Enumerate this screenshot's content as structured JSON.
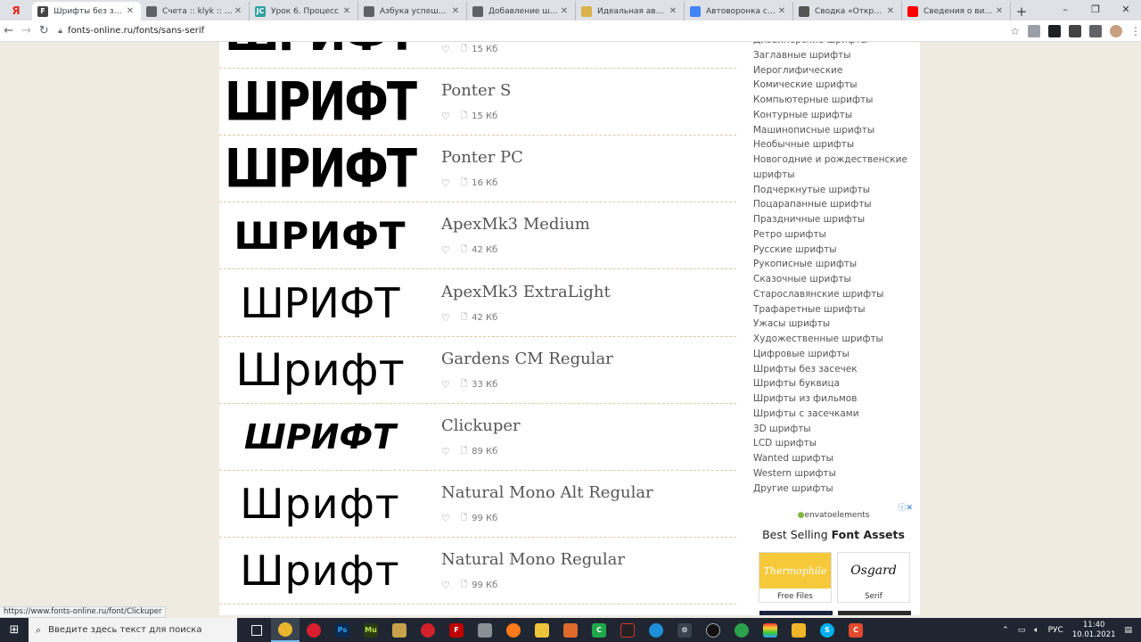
{
  "browser": {
    "tabs": [
      {
        "title": "Шрифты без засечек",
        "color": "#ffffff",
        "fav_text": "F",
        "fav_color": "#444444",
        "active": true
      },
      {
        "title": "Счета :: klyk :: justclick",
        "color": "",
        "fav_text": "",
        "fav_color": "#5f6368"
      },
      {
        "title": "Урок 6. Процесс",
        "color": "",
        "fav_text": "JC",
        "fav_color": "#30a0a0"
      },
      {
        "title": "Азбука успешного бизнеса",
        "color": "",
        "fav_text": "",
        "fav_color": "#5f6368"
      },
      {
        "title": "Добавление шрифтов",
        "color": "",
        "fav_text": "",
        "fav_color": "#5f6368"
      },
      {
        "title": "Идеальная автоворонка",
        "color": "",
        "fav_text": "",
        "fav_color": "#d9b24c"
      },
      {
        "title": "Автоворонка с нуля",
        "color": "",
        "fav_text": "",
        "fav_color": "#4285f4"
      },
      {
        "title": "Сводка «Открытки»",
        "color": "",
        "fav_text": "",
        "fav_color": "#555555"
      },
      {
        "title": "Сведения о видео - YouTube",
        "color": "",
        "fav_text": "",
        "fav_color": "#ff0000"
      }
    ],
    "url": "fonts-online.ru/fonts/sans-serif",
    "status_url": "https://www.fonts-online.ru/font/Clickuper"
  },
  "fonts": [
    {
      "name": "",
      "size": "15 Кб",
      "preview": "ШРИФТ"
    },
    {
      "name": "Ponter S",
      "size": "15 Кб",
      "preview": "ШРИФТ"
    },
    {
      "name": "Ponter PC",
      "size": "16 Кб",
      "preview": "ШРИФТ"
    },
    {
      "name": "ApexMk3 Medium",
      "size": "42 Кб",
      "preview": "ШРИФТ"
    },
    {
      "name": "ApexMk3 ExtraLight",
      "size": "42 Кб",
      "preview": "ШРИФТ"
    },
    {
      "name": "Gardens CM Regular",
      "size": "33 Кб",
      "preview": "Шрифт"
    },
    {
      "name": "Clickuper",
      "size": "89 Кб",
      "preview": "ШРИФТ"
    },
    {
      "name": "Natural Mono Alt Regular",
      "size": "99 Кб",
      "preview": "Шрифт"
    },
    {
      "name": "Natural Mono Regular",
      "size": "99 Кб",
      "preview": "Шрифт"
    }
  ],
  "categories": [
    "Дизайнерские шрифты",
    "Заглавные шрифты",
    "Иероглифические",
    "Комические шрифты",
    "Компьютерные шрифты",
    "Контурные шрифты",
    "Машинописные шрифты",
    "Необычные шрифты",
    "Новогодние и рождественские шрифты",
    "Подчеркнутые шрифты",
    "Поцарапанные шрифты",
    "Праздничные шрифты",
    "Ретро шрифты",
    "Русские шрифты",
    "Рукописные шрифты",
    "Сказочные шрифты",
    "Старославянские шрифты",
    "Трафаретные шрифты",
    "Ужасы шрифты",
    "Художественные шрифты",
    "Цифровые шрифты",
    "Шрифты без засечек",
    "Шрифты буквица",
    "Шрифты из фильмов",
    "Шрифты с засечками",
    "3D шрифты",
    "LCD шрифты",
    "Wanted шрифты",
    "Western шрифты",
    "Другие шрифты"
  ],
  "ad": {
    "brand": "envatoelements",
    "title_plain": "Best Selling ",
    "title_bold": "Font Assets",
    "tiles": [
      {
        "img_text": "Thermophile",
        "label": "Free Files",
        "bg": "#f5c93a"
      },
      {
        "img_text": "Osgard",
        "label": "Serif",
        "bg": "#ffffff"
      }
    ]
  },
  "taskbar": {
    "search_placeholder": "Введите здесь текст для поиска",
    "lang": "РУС",
    "time": "11:40",
    "date": "10.01.2021"
  }
}
